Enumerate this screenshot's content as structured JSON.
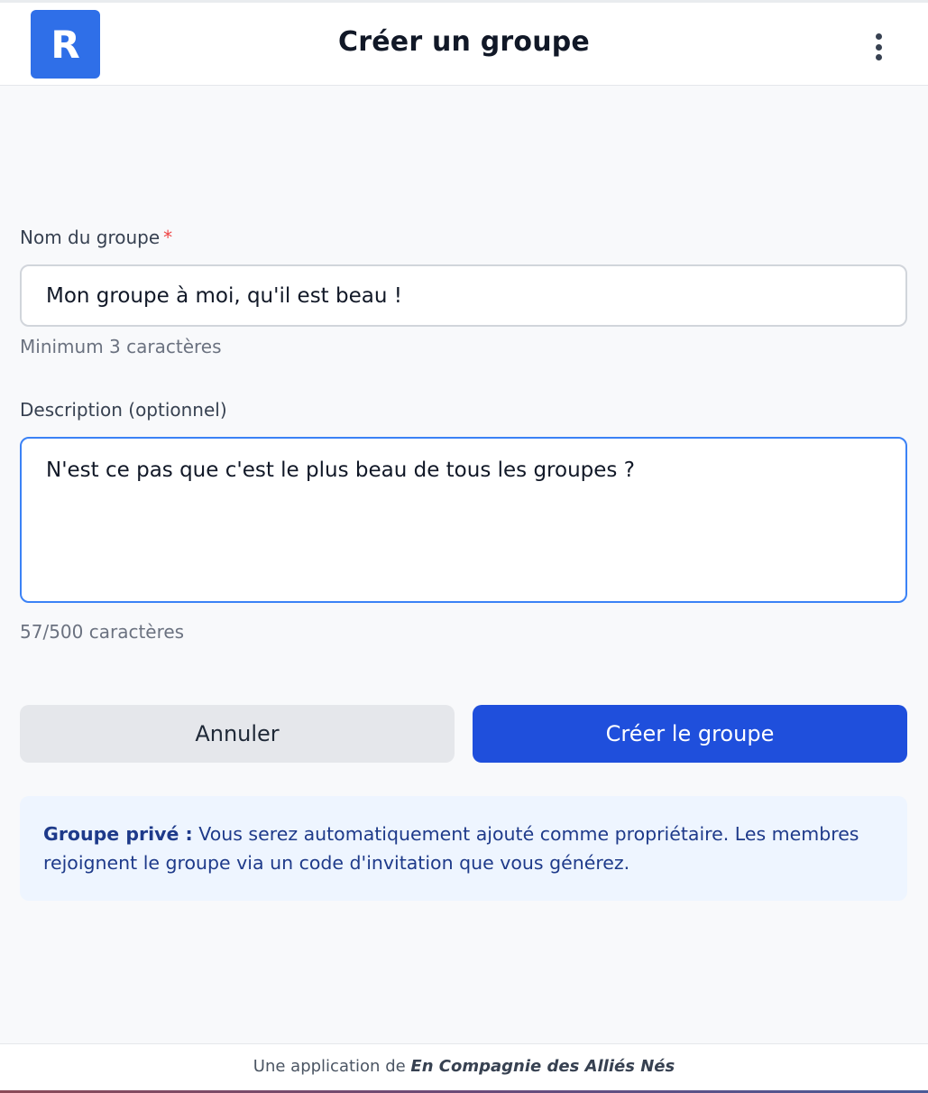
{
  "header": {
    "logo_letter": "R",
    "title": "Créer un groupe",
    "menu_icon": "more-vertical-icon"
  },
  "form": {
    "name": {
      "label": "Nom du groupe",
      "required_mark": "*",
      "value": "Mon groupe à moi, qu'il est beau !",
      "hint": "Minimum 3 caractères"
    },
    "description": {
      "label": "Description (optionnel)",
      "value": "N'est ce pas que c'est le plus beau de tous les groupes ?",
      "counter": "57/500 caractères"
    }
  },
  "actions": {
    "cancel_label": "Annuler",
    "submit_label": "Créer le groupe"
  },
  "info": {
    "title": "Groupe privé :",
    "text": " Vous serez automatiquement ajouté comme propriétaire. Les membres rejoignent le groupe via un code d'invitation que vous générez."
  },
  "footer": {
    "prefix": "Une application de ",
    "org": "En Compagnie des Alliés Nés"
  },
  "colors": {
    "primary": "#1f4fdc",
    "logo": "#2f6fe8",
    "info_bg": "#eef5ff",
    "required": "#ef4444"
  }
}
